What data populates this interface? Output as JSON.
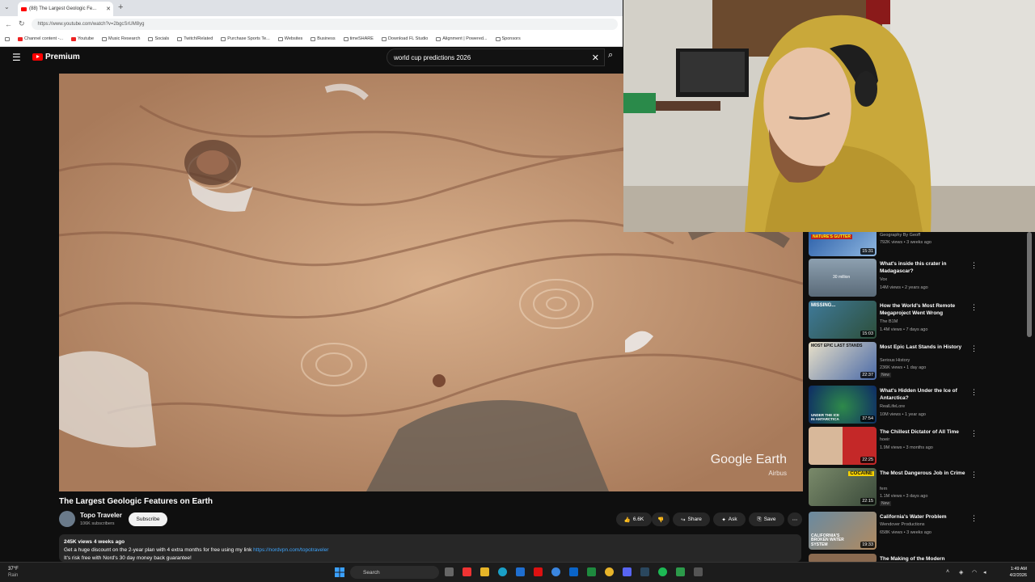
{
  "browser": {
    "tab_title": "(88) The Largest Geologic Fe...",
    "url": "https://www.youtube.com/watch?v=2bgcSrUM8yg",
    "bookmarks": [
      "Channel content -...",
      "Youtube",
      "Music Research",
      "Socials",
      "Twitch/Related",
      "Purchase Sports Te...",
      "Websites",
      "Business",
      "timeSHARE",
      "Download FL Studio",
      "Alignment | Powered...",
      "Sponsors"
    ]
  },
  "youtube": {
    "logo_text": "Premium",
    "search_value": "world cup predictions 2026"
  },
  "video": {
    "watermark": "Google Earth",
    "watermark_sub": "Airbus",
    "title": "The Largest Geologic Features on Earth",
    "channel": "Topo Traveler",
    "subscribers": "106K subscribers",
    "subscribe_label": "Subscribe",
    "likes": "6.6K",
    "share_label": "Share",
    "ask_label": "Ask",
    "save_label": "Save",
    "views_age": "245K views  4 weeks ago",
    "desc_line1": "Get a huge discount on the 2-year plan with 4 extra months for free using my link",
    "desc_link": "https://nordvpn.com/topotraveler",
    "desc_line2": "It's risk free with Nord's 30 day money back guarantee!"
  },
  "recommendations": [
    {
      "title": "",
      "channel": "Geography By Geoff",
      "meta": "792K views • 3 weeks ago",
      "duration": "15:31",
      "new": ""
    },
    {
      "title": "What's inside this crater in Madagascar?",
      "channel": "Vox",
      "meta": "14M views • 2 years ago",
      "duration": "",
      "new": ""
    },
    {
      "title": "How the World's Most Remote Megaproject Went Wrong",
      "channel": "The B1M",
      "meta": "1.4M views • 7 days ago",
      "duration": "15:03",
      "new": ""
    },
    {
      "title": "Most Epic Last Stands in History",
      "channel": "Serious History",
      "meta": "236K views • 1 day ago",
      "duration": "22:37",
      "new": "New"
    },
    {
      "title": "What's Hidden Under the Ice of Antarctica?",
      "channel": "RealLifeLore",
      "meta": "10M views • 1 year ago",
      "duration": "37:54",
      "new": ""
    },
    {
      "title": "The Chillest Dictator of All Time",
      "channel": "hoeir",
      "meta": "1.9M views • 3 months ago",
      "duration": "22:25",
      "new": ""
    },
    {
      "title": "The Most Dangerous Job in Crime",
      "channel": "fern",
      "meta": "1.1M views • 3 days ago",
      "duration": "22:15",
      "new": "New"
    },
    {
      "title": "California's Water Problem",
      "channel": "Wendover Productions",
      "meta": "658K views • 3 weeks ago",
      "duration": "19:33",
      "new": ""
    },
    {
      "title": "The Making of the Modern",
      "channel": "",
      "meta": "",
      "duration": "",
      "new": ""
    }
  ],
  "thumb_labels": [
    "NATURE'S GUTTER",
    "30 million",
    "MISSING...",
    "MOST EPIC LAST STANDS",
    "UNDER THE ICE IN ANTARCTICA",
    "",
    "COCAINE",
    "CALIFORNIA'S BROKEN WATER SYSTEM",
    ""
  ],
  "taskbar": {
    "weather_temp": "37°F",
    "weather_desc": "Rain",
    "search": "Search",
    "time": "1:49 AM",
    "date": "4/2/2026"
  },
  "colors": {
    "accent": "#ff0000",
    "link": "#3ea6ff"
  }
}
